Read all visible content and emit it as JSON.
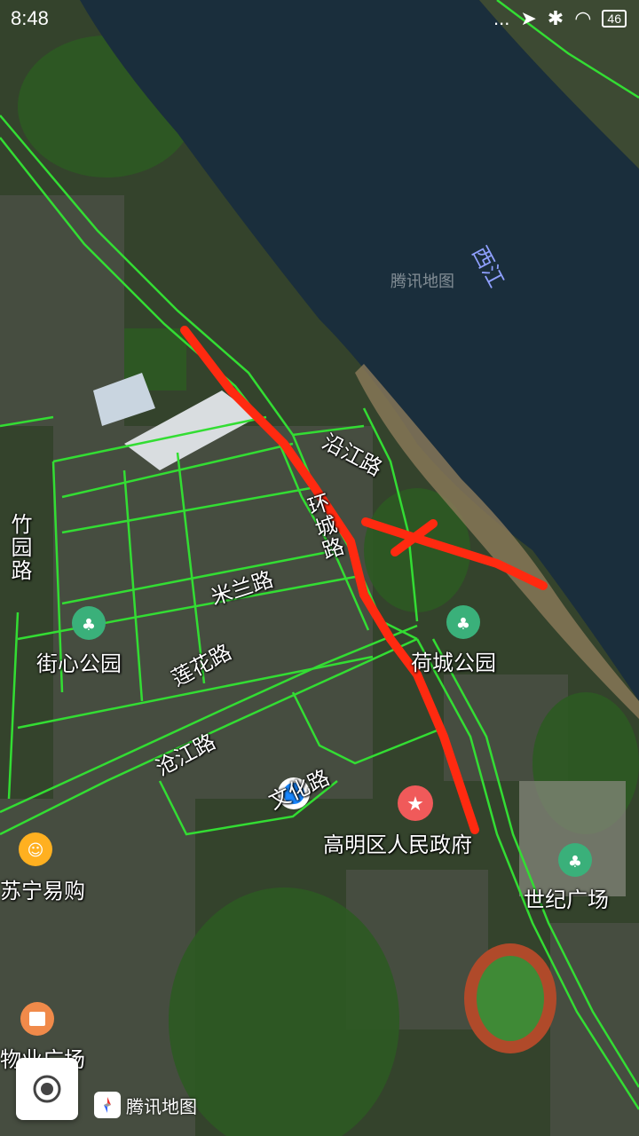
{
  "status_bar": {
    "time": "8:48",
    "battery": "46",
    "dots": "...",
    "icons": [
      "signal-icon",
      "bluetooth-icon",
      "wifi-icon"
    ]
  },
  "river": {
    "label": "西江"
  },
  "watermark": "腾讯地图",
  "roads": {
    "yanjiang": "沿江路",
    "huancheng": "环城路",
    "milan": "米兰路",
    "lianhua": "莲花路",
    "cangjiang": "沧江路",
    "zhuyuan": "竹园路",
    "wenhua": "文化路"
  },
  "pois": {
    "jiexin_park": "街心公园",
    "hecheng_park": "荷城公园",
    "gov": "高明区人民政府",
    "century_square": "世纪广场",
    "suning": "苏宁易购",
    "wuye_plaza": "物业广场"
  },
  "colors": {
    "road": "#33dd33",
    "route_mark": "#ff2a10",
    "location": "#1a88ff",
    "water": "#1a2e3c"
  },
  "logo": {
    "text": "腾讯地图",
    "icon": "compass-icon"
  },
  "controls": {
    "locate_icon": "locate-icon"
  }
}
